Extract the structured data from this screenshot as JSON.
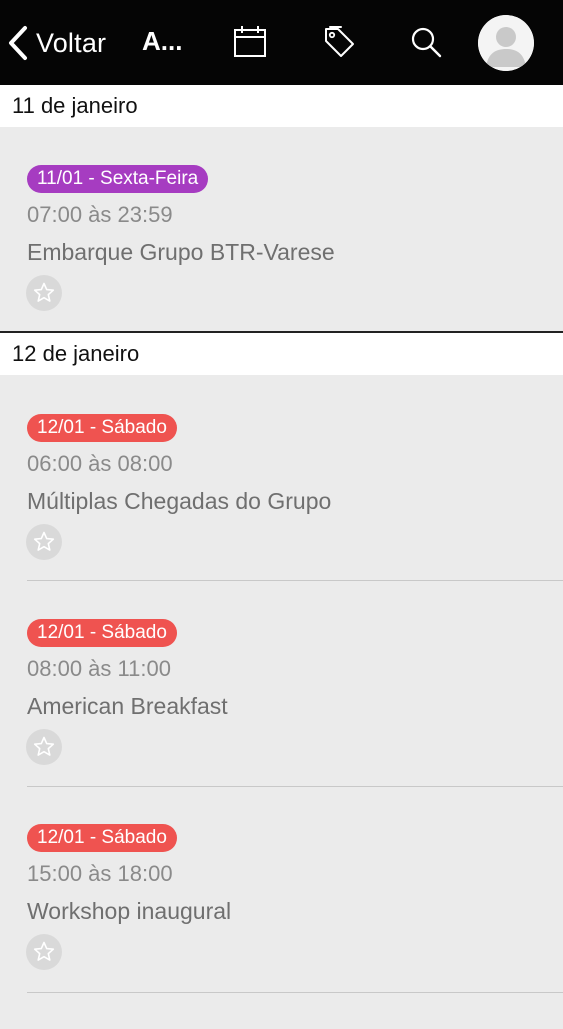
{
  "navbar": {
    "back_label": "Voltar",
    "title": "A...",
    "icons": [
      "chevron-left-icon",
      "calendar-icon",
      "tag-icon",
      "search-icon",
      "user-avatar"
    ]
  },
  "colors": {
    "navbar_bg": "#050505",
    "badge_friday": "#a63cc1",
    "badge_saturday": "#ef5350",
    "background": "#ebebeb"
  },
  "sections": [
    {
      "header": "11 de janeiro",
      "events": [
        {
          "badge": "11/01 - Sexta-Feira",
          "time": "07:00 às 23:59",
          "title": "Embarque Grupo BTR-Varese",
          "favorite_icon": "star-outline-icon"
        }
      ]
    },
    {
      "header": "12 de janeiro",
      "events": [
        {
          "badge": "12/01 - Sábado",
          "time": "06:00 às 08:00",
          "title": "Múltiplas Chegadas do Grupo",
          "favorite_icon": "star-outline-icon"
        },
        {
          "badge": "12/01 - Sábado",
          "time": "08:00 às 11:00",
          "title": "American Breakfast",
          "favorite_icon": "star-outline-icon"
        },
        {
          "badge": "12/01 - Sábado",
          "time": "15:00 às 18:00",
          "title": "Workshop inaugural",
          "favorite_icon": "star-outline-icon"
        }
      ]
    }
  ]
}
